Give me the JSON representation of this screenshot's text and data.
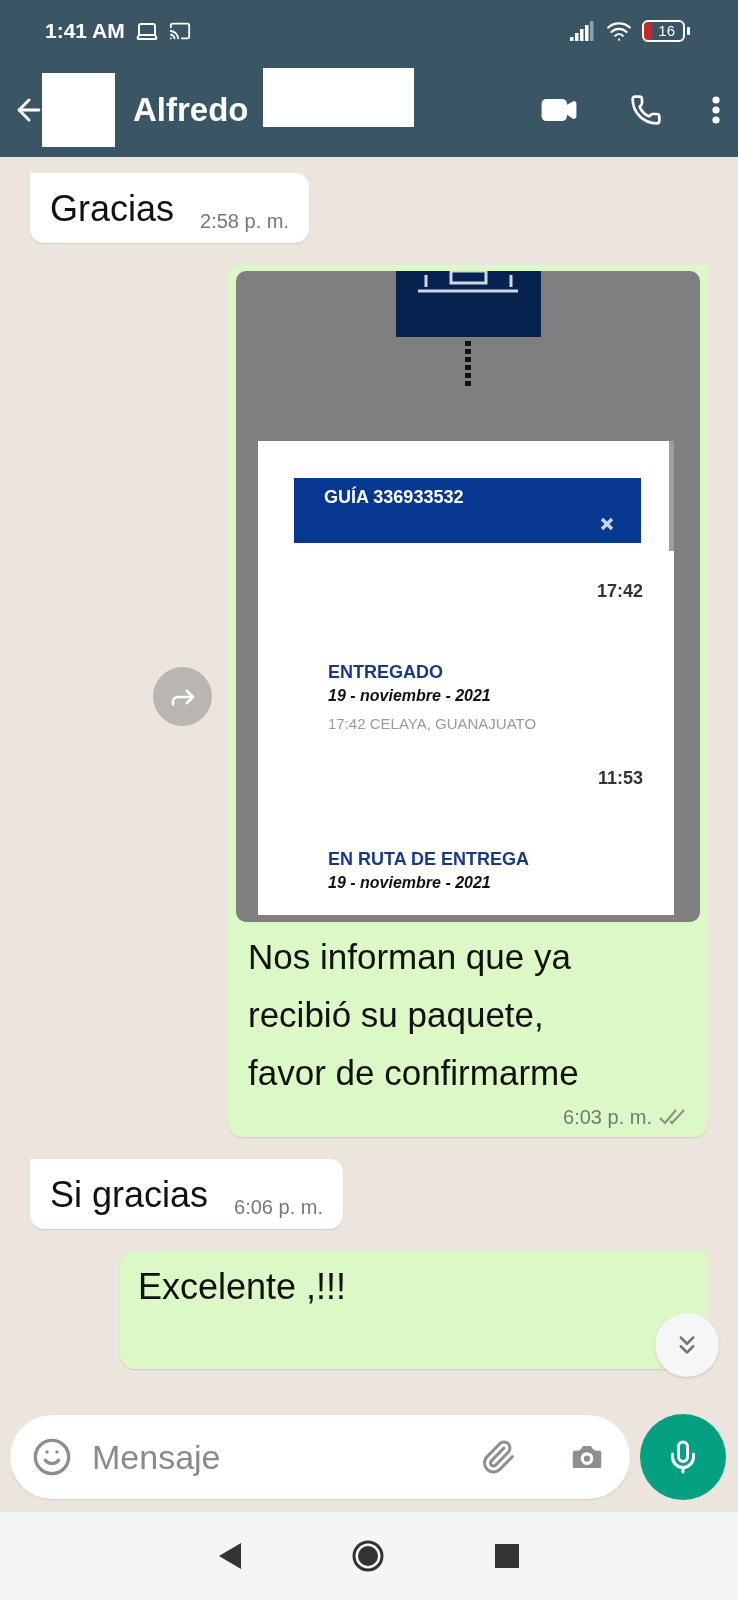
{
  "status_bar": {
    "time": "1:41 AM",
    "battery": "16"
  },
  "header": {
    "contact_name": "Alfredo"
  },
  "messages": [
    {
      "kind": "text",
      "outgoing": false,
      "text": "Gracias",
      "time": "2:58 p. m."
    },
    {
      "kind": "image",
      "outgoing": true,
      "screenshot": {
        "guide_title": "GUÍA 336933532",
        "events": [
          {
            "time": "17:42",
            "status": "ENTREGADO",
            "date": "19 - noviembre - 2021",
            "location": "17:42 CELAYA, GUANAJUATO"
          },
          {
            "time": "11:53",
            "status": "EN RUTA DE ENTREGA",
            "date": "19 - noviembre - 2021"
          }
        ]
      },
      "caption": "Nos informan que ya\nrecibió su paquete,\nfavor de confirmarme",
      "time": "6:03 p. m.",
      "read": false
    },
    {
      "kind": "text",
      "outgoing": false,
      "text": "Si gracias",
      "time": "6:06 p. m."
    },
    {
      "kind": "text",
      "outgoing": true,
      "text": "Excelente ,!!!"
    }
  ],
  "composer": {
    "placeholder": "Mensaje"
  }
}
